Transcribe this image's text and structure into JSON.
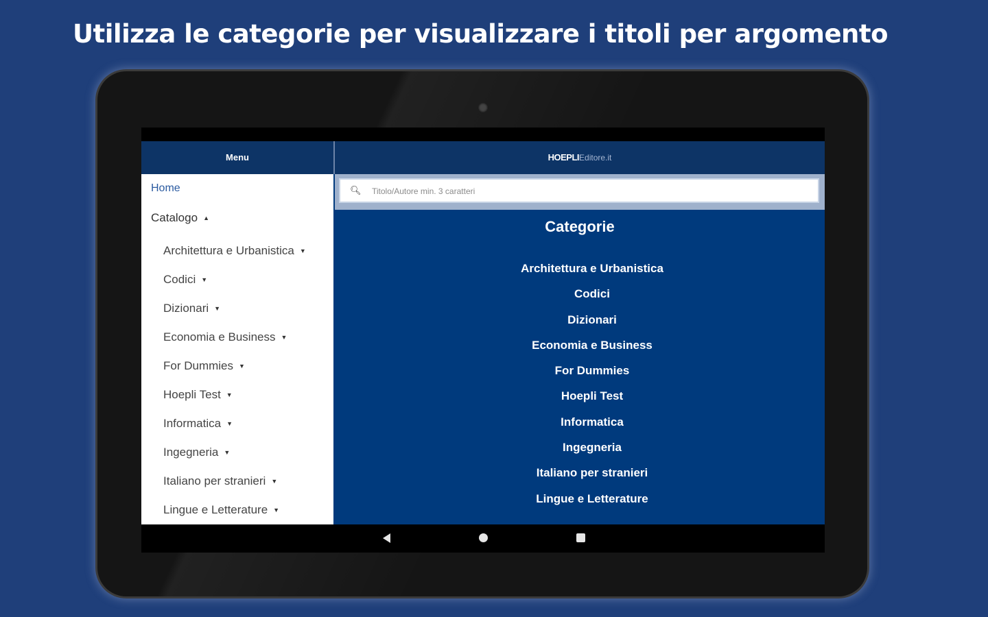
{
  "headline": "Utilizza le categorie per visualizzare i titoli per argomento",
  "topbar": {
    "menu_label": "Menu",
    "brand_strong": "HOEPLI",
    "brand_light": "Editore.it"
  },
  "sidebar": {
    "home": "Home",
    "catalog": "Catalogo",
    "catalog_caret": "▲",
    "item_caret": "▼",
    "items": [
      {
        "label": "Architettura e Urbanistica"
      },
      {
        "label": "Codici"
      },
      {
        "label": "Dizionari"
      },
      {
        "label": "Economia e Business"
      },
      {
        "label": "For Dummies"
      },
      {
        "label": "Hoepli Test"
      },
      {
        "label": "Informatica"
      },
      {
        "label": "Ingegneria"
      },
      {
        "label": "Italiano per stranieri"
      },
      {
        "label": "Lingue e Letterature"
      }
    ]
  },
  "search": {
    "placeholder": "Titolo/Autore min. 3 caratteri",
    "icon": "search-icon"
  },
  "categories": {
    "title": "Categorie",
    "items": [
      {
        "label": "Architettura e Urbanistica"
      },
      {
        "label": "Codici"
      },
      {
        "label": "Dizionari"
      },
      {
        "label": "Economia e Business"
      },
      {
        "label": "For Dummies"
      },
      {
        "label": "Hoepli Test"
      },
      {
        "label": "Informatica"
      },
      {
        "label": "Ingegneria"
      },
      {
        "label": "Italiano per stranieri"
      },
      {
        "label": "Lingue e Letterature"
      }
    ]
  },
  "colors": {
    "background": "#1f3f7a",
    "app_blue": "#003a7d",
    "topbar": "#0d3466"
  }
}
